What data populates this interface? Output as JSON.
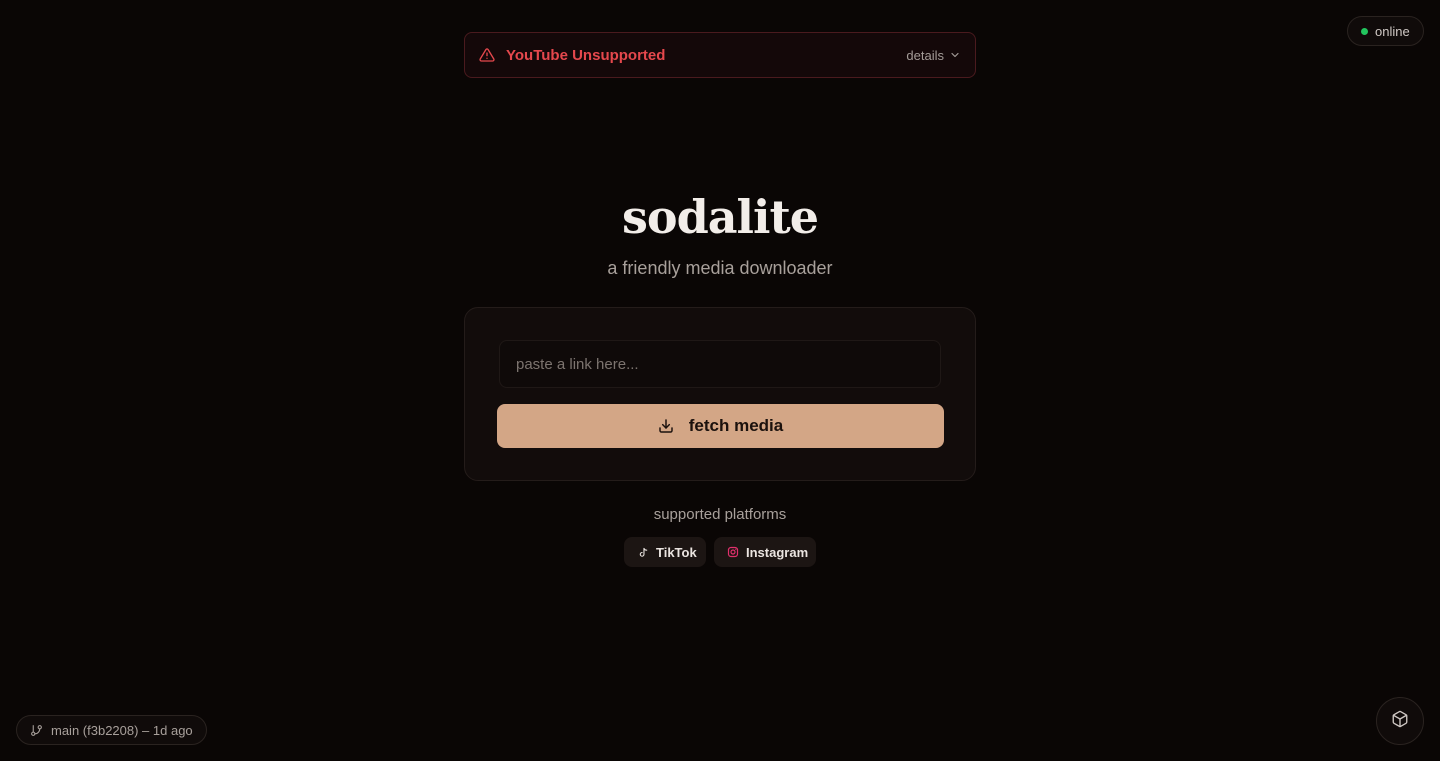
{
  "alert": {
    "title": "YouTube Unsupported",
    "details_label": "details",
    "icon": "warning-triangle-icon"
  },
  "status": {
    "label": "online",
    "color": "#22c55e"
  },
  "hero": {
    "brand": "sodalite",
    "tagline": "a friendly media downloader"
  },
  "form": {
    "placeholder": "paste a link here...",
    "value": "",
    "button_label": "fetch media",
    "button_color": "#d3a686"
  },
  "platforms": {
    "title": "supported platforms",
    "items": [
      {
        "label": "TikTok",
        "icon": "tiktok-icon"
      },
      {
        "label": "Instagram",
        "icon": "instagram-icon",
        "color": "#e1306c"
      }
    ]
  },
  "footer": {
    "branch_label": "main (f3b2208) – 1d ago",
    "branch_icon": "git-branch-icon",
    "corner_icon": "package-icon"
  },
  "colors": {
    "background": "#0a0605",
    "accent": "#d3a686",
    "error": "#e5484d"
  }
}
